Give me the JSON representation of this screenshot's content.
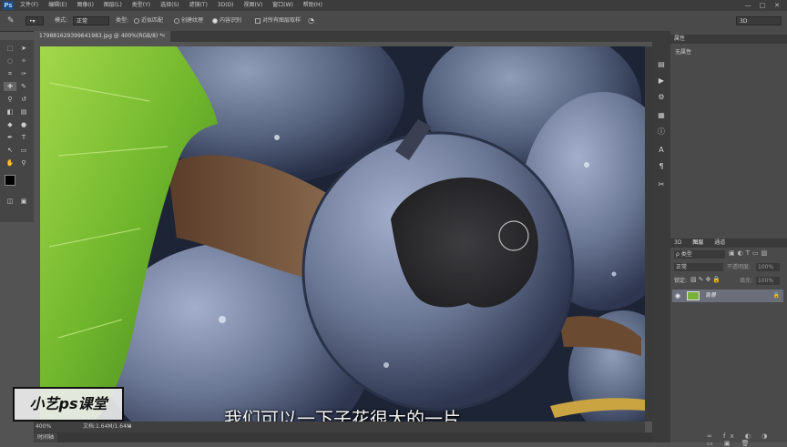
{
  "app": {
    "logo": "Ps"
  },
  "menu": [
    "文件(F)",
    "编辑(E)",
    "图像(I)",
    "图层(L)",
    "类型(Y)",
    "选择(S)",
    "滤镜(T)",
    "3D(D)",
    "视图(V)",
    "窗口(W)",
    "帮助(H)"
  ],
  "window_controls": [
    "—",
    "□",
    "✕"
  ],
  "options": {
    "mode_label": "模式:",
    "mode_value": "正常",
    "type_label": "类型:",
    "type_options": [
      "近似匹配",
      "创建纹理",
      "内容识别"
    ],
    "type_selected": 2,
    "sample_all": "对所有图层取样",
    "workspace": "3D"
  },
  "document": {
    "tab_title": "179881629399641983.jpg @ 400%(RGB/8) *",
    "zoom": "400%",
    "doc_info": "文档:1.64M/1.64M"
  },
  "timeline_tab": "时间轴",
  "panels": {
    "properties_tab": "属性",
    "properties_text": "无属性",
    "layers_tabs": [
      "3D",
      "图层",
      "通道"
    ],
    "kind_label": "ρ 类型",
    "blend_mode": "正常",
    "opacity_label": "不透明度:",
    "opacity_value": "100%",
    "lock_label": "锁定:",
    "fill_label": "填充:",
    "fill_value": "100%",
    "layer_name": "背景"
  },
  "subtitle": "我们可以一下子花很大的一片",
  "watermark": "小艺ps课堂",
  "colors": {
    "accent": "#1f4a7c",
    "panel": "#4a4a4a"
  }
}
